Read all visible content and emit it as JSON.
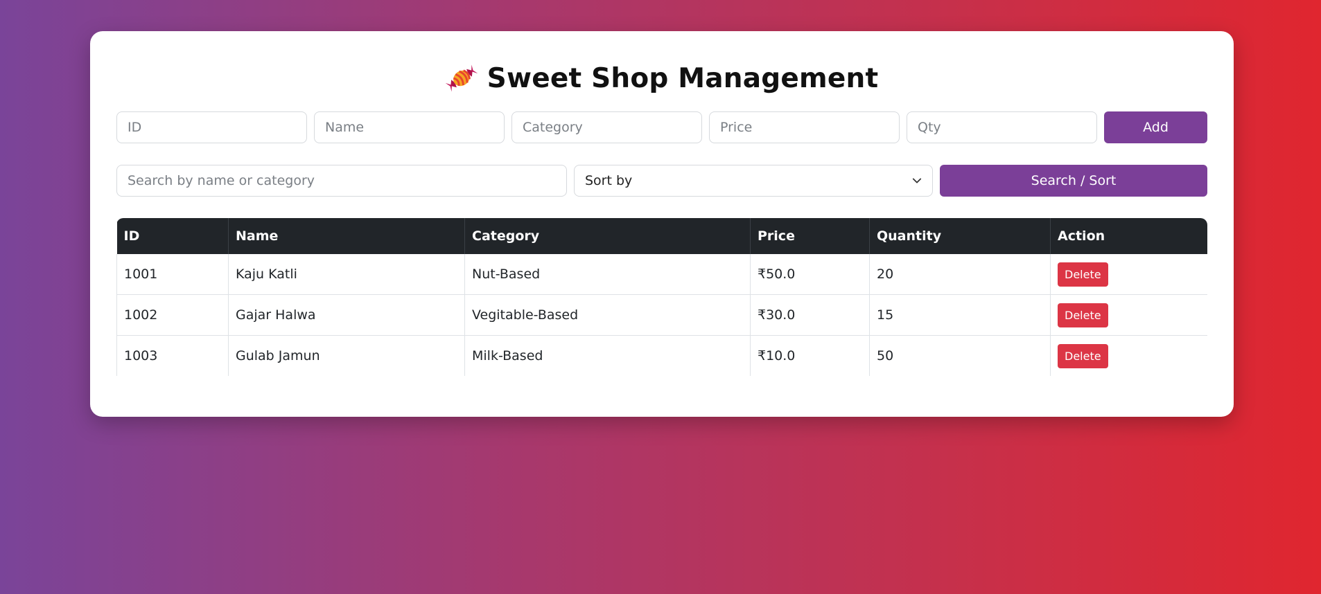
{
  "app": {
    "title": "Sweet Shop Management",
    "title_icon": "candy-icon"
  },
  "add_form": {
    "id_placeholder": "ID",
    "name_placeholder": "Name",
    "category_placeholder": "Category",
    "price_placeholder": "Price",
    "qty_placeholder": "Qty",
    "add_label": "Add"
  },
  "search": {
    "placeholder": "Search by name or category",
    "sort_label": "Sort by",
    "button_label": "Search / Sort"
  },
  "table": {
    "headers": {
      "id": "ID",
      "name": "Name",
      "category": "Category",
      "price": "Price",
      "quantity": "Quantity",
      "action": "Action"
    },
    "rows": [
      {
        "id": "1001",
        "name": "Kaju Katli",
        "category": "Nut-Based",
        "price": "₹50.0",
        "quantity": "20",
        "action": "Delete"
      },
      {
        "id": "1002",
        "name": "Gajar Halwa",
        "category": "Vegitable-Based",
        "price": "₹30.0",
        "quantity": "15",
        "action": "Delete"
      },
      {
        "id": "1003",
        "name": "Gulab Jamun",
        "category": "Milk-Based",
        "price": "₹10.0",
        "quantity": "50",
        "action": "Delete"
      }
    ]
  },
  "colors": {
    "accent_purple": "#7b3f98",
    "delete_red": "#dc3545",
    "header_dark": "#212529"
  }
}
